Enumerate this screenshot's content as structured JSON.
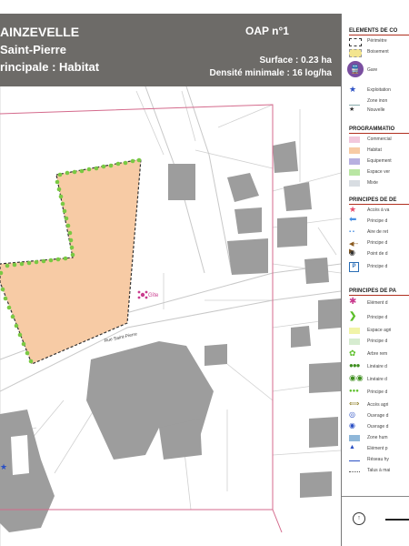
{
  "header": {
    "title_line1": "AINZEVELLE",
    "title_line2": "Saint-Pierre",
    "title_line3": "rincipale : Habitat",
    "oap_label": "OAP n°1",
    "surface": "Surface : 0.23 ha",
    "density": "Densité minimale : 16 log/ha"
  },
  "map": {
    "street_label": "Rue Saint-Pierre",
    "poi_label": "Gîte",
    "colors": {
      "habitat": "#f7cba5",
      "hedge": "#7ac943",
      "perimeter": "#d46a8c",
      "building": "#9d9d9d",
      "road_edge": "#cfcfcf",
      "header_bg": "#6d6b68"
    }
  },
  "legend": {
    "section1": "ELEMENTS DE CO",
    "items1": [
      "Périmètre",
      "Boisement",
      "Gare",
      "Exploitation",
      "Zone inon",
      "Nouvelle"
    ],
    "section2": "PROGRAMMATIO",
    "items2": [
      "Commercial",
      "Habitat",
      "Equipement",
      "Espace ver",
      "Mixte"
    ],
    "section3": "PRINCIPES DE DE",
    "items3": [
      "Accès à va",
      "Principe d",
      "Aire de ret",
      "Principe d",
      "Point de d",
      "Principe d"
    ],
    "section4": "PRINCIPES DE PA",
    "items4": [
      "Elément d",
      "Principe d",
      "Espace agri",
      "Principe d",
      "Arbre rem",
      "Linéaire d",
      "Linéaire d",
      "Principe d",
      "Accès agri",
      "Ouvrage d",
      "Ouvrage d",
      "Zone hum",
      "Elément p",
      "Réseau hy",
      "Talus à mai"
    ]
  }
}
